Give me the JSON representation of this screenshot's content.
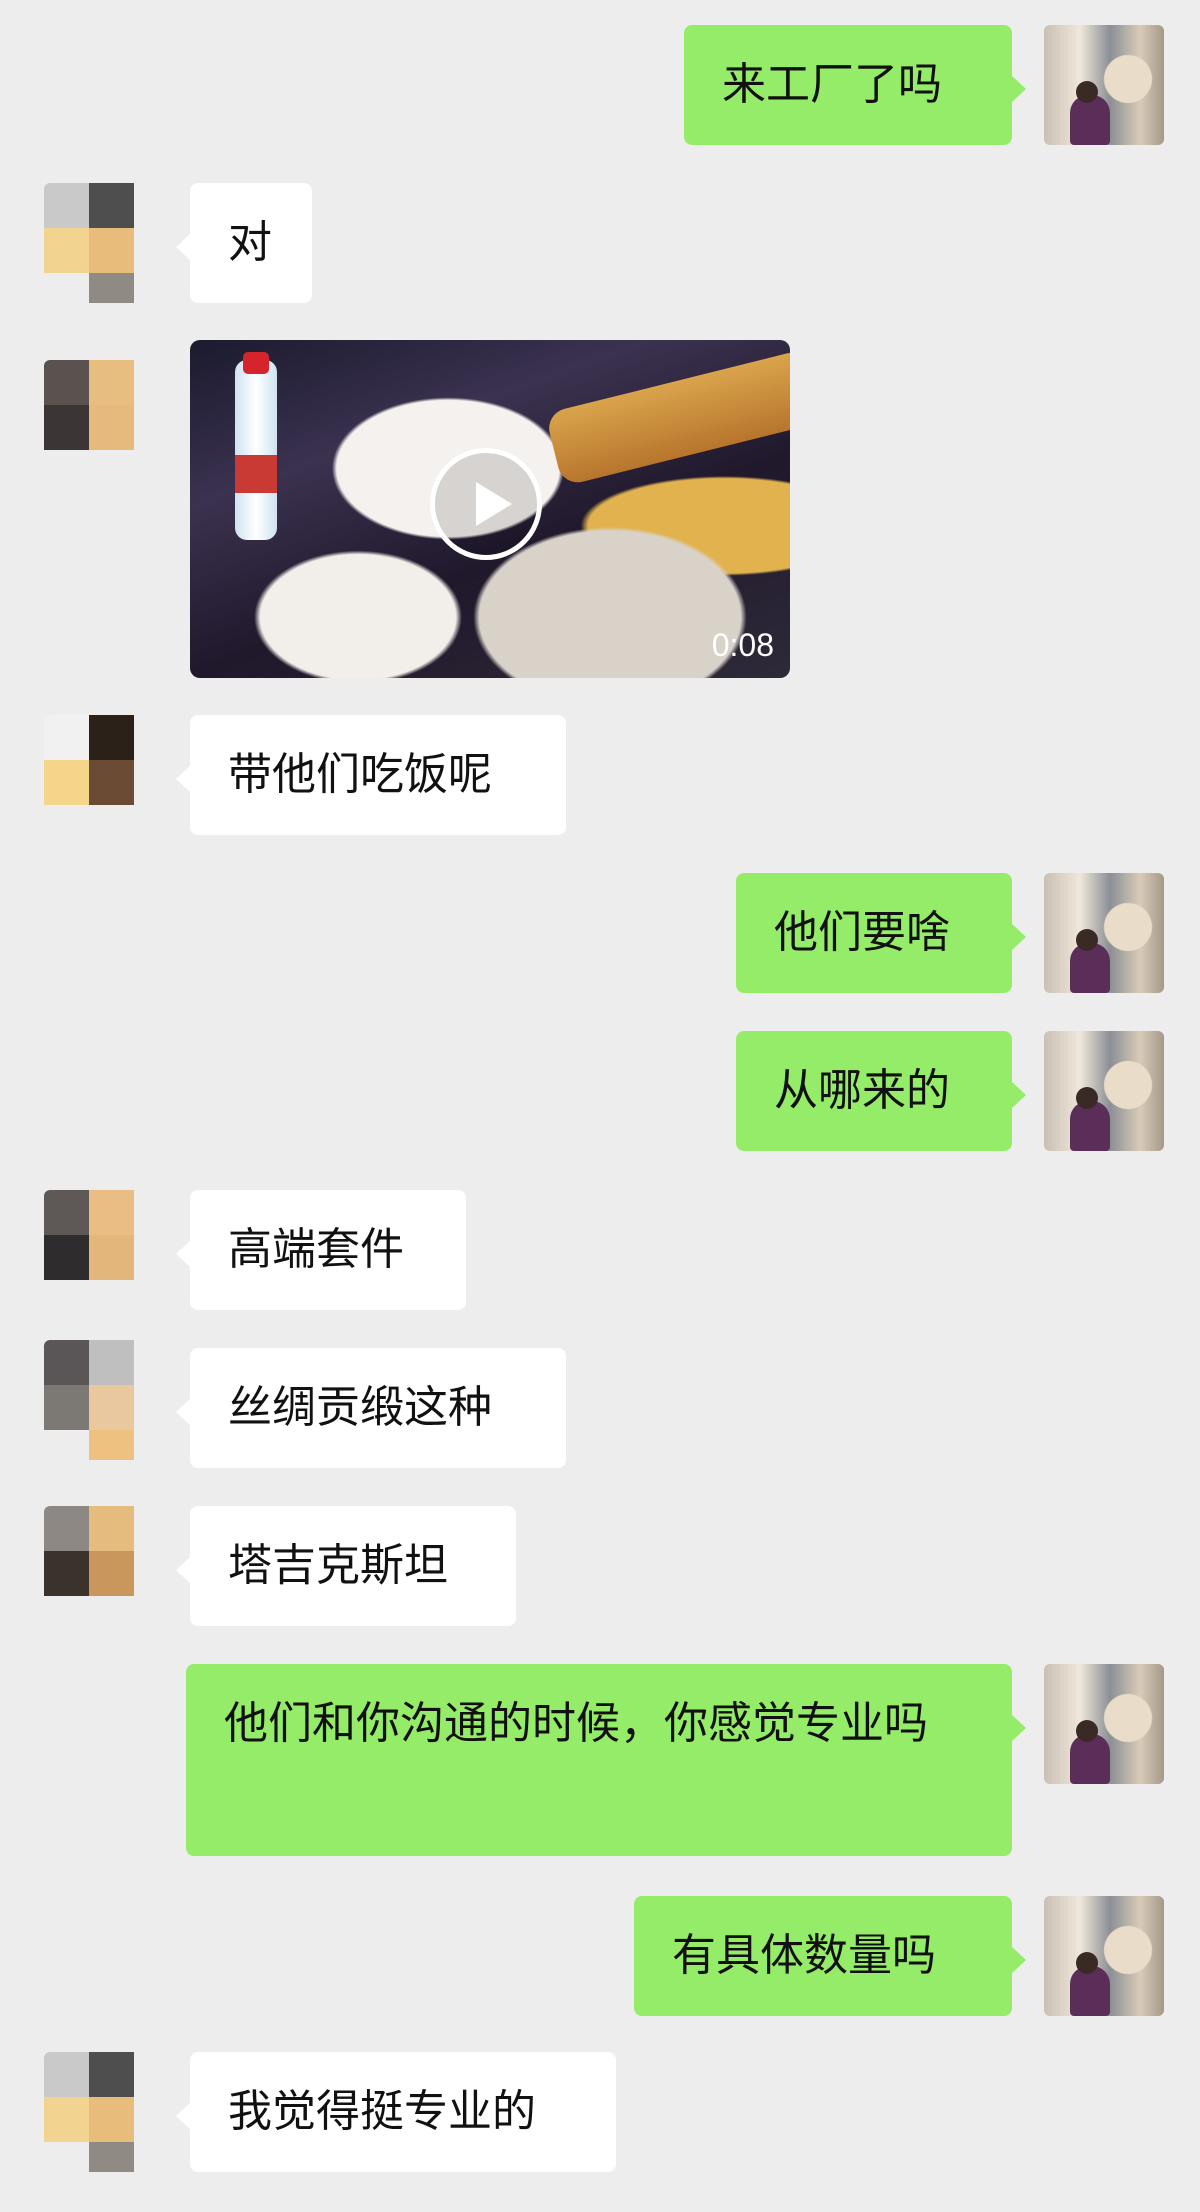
{
  "messages": [
    {
      "from": "me",
      "text": "来工厂了吗"
    },
    {
      "from": "contact",
      "text": "对"
    },
    {
      "from": "contact",
      "type": "video",
      "duration": "0:08"
    },
    {
      "from": "contact",
      "text": "带他们吃饭呢"
    },
    {
      "from": "me",
      "text": "他们要啥"
    },
    {
      "from": "me",
      "text": "从哪来的"
    },
    {
      "from": "contact",
      "text": "高端套件"
    },
    {
      "from": "contact",
      "text": "丝绸贡缎这种"
    },
    {
      "from": "contact",
      "text": "塔吉克斯坦"
    },
    {
      "from": "me",
      "text": "他们和你沟通的时候，你感觉专业吗"
    },
    {
      "from": "me",
      "text": "有具体数量吗"
    },
    {
      "from": "contact",
      "text": "我觉得挺专业的"
    }
  ],
  "colors": {
    "background": "#ededed",
    "my_bubble": "#95ec69",
    "contact_bubble": "#ffffff"
  }
}
